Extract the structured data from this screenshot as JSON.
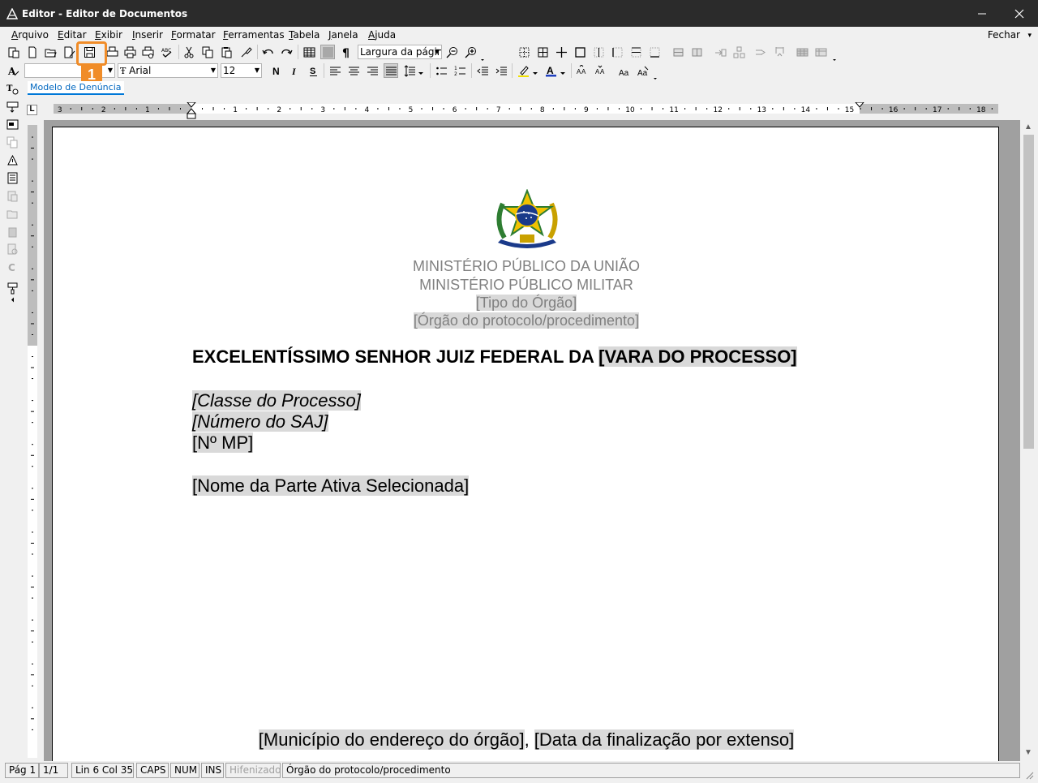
{
  "window": {
    "title": "Editor - Editor de Documentos"
  },
  "menu": {
    "items": [
      {
        "label": "Arquivo",
        "accel": "A",
        "rest": "rquivo"
      },
      {
        "label": "Editar",
        "accel": "E",
        "rest": "ditar"
      },
      {
        "label": "Exibir",
        "accel": "E",
        "rest": "xibir"
      },
      {
        "label": "Inserir",
        "accel": "I",
        "rest": "nserir"
      },
      {
        "label": "Formatar",
        "accel": "F",
        "rest": "ormatar"
      },
      {
        "label": "Ferramentas",
        "accel": "F",
        "rest": "erramentas"
      },
      {
        "label": "Tabela",
        "accel": "T",
        "rest": "abela"
      },
      {
        "label": "Janela",
        "accel": "J",
        "rest": "anela"
      },
      {
        "label": "Ajuda",
        "accel": "A",
        "rest": "juda"
      }
    ],
    "close_label": "Fechar"
  },
  "toolbar": {
    "zoom_value": "Largura da págin",
    "style_value": "",
    "font_value": "Arial",
    "font_size_value": "12"
  },
  "callout": {
    "number": "1"
  },
  "tab": {
    "label": "Modelo de Denúncia"
  },
  "ruler": {
    "left_numbers": [
      "3",
      "2",
      "1"
    ],
    "numbers": [
      "1",
      "2",
      "3",
      "4",
      "5",
      "6",
      "7",
      "8",
      "9",
      "10",
      "11",
      "12",
      "13",
      "14",
      "15",
      "16",
      "17",
      "18"
    ]
  },
  "document": {
    "header_lines": [
      "MINISTÉRIO PÚBLICO DA UNIÃO",
      "MINISTÉRIO PÚBLICO MILITAR"
    ],
    "field_tipo_orgao": "[Tipo do Órgão]",
    "field_orgao_protocolo": "[Órgão do protocolo/procedimento]",
    "vocativo_prefix": "EXCELENTÍSSIMO SENHOR JUIZ FEDERAL DA ",
    "vocativo_field": "[VARA DO PROCESSO]",
    "classe_processo": "[Classe do Processo]",
    "numero_saj": "[Número do SAJ]",
    "numero_mp": "[Nº MP]",
    "parte_ativa": "[Nome da Parte Ativa Selecionada]",
    "municipio": "[Município do endereço do órgão]",
    "separator": ", ",
    "data_extenso": "[Data da finalização por extenso]"
  },
  "statusbar": {
    "page": "Pág 1",
    "page_of": "1/1",
    "position": "Lin 6  Col 35",
    "caps": "CAPS",
    "num": "NUM",
    "ins": "INS",
    "hyphen": "Hifenizado",
    "context": "Órgão do protocolo/procedimento"
  },
  "colors": {
    "titlebar": "#2b2b2b",
    "callout": "#f08c28",
    "tab_accent": "#0078d7",
    "field_bg": "#d9d9d9",
    "header_text": "#808080"
  }
}
